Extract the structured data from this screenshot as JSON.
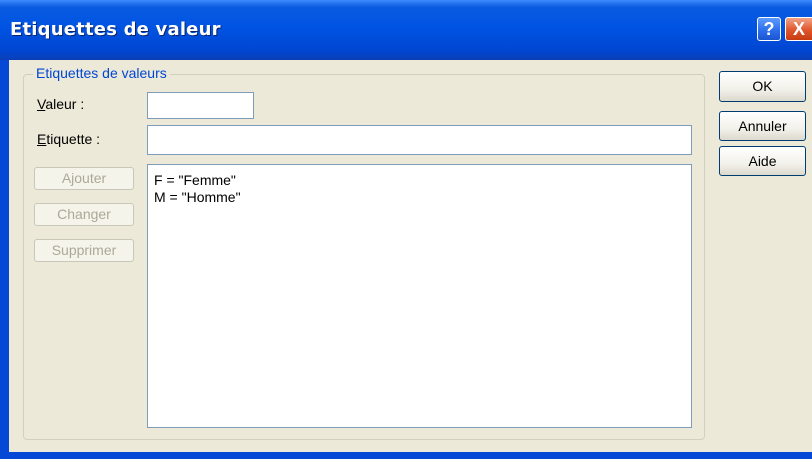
{
  "window": {
    "title": "Etiquettes de valeur"
  },
  "titlebar_buttons": {
    "help": "?",
    "close": "X"
  },
  "group": {
    "legend": "Etiquettes de valeurs"
  },
  "form": {
    "valeur_label": "Valeur :",
    "valeur_value": "",
    "etiquette_label": "Etiquette :",
    "etiquette_value": ""
  },
  "actions": {
    "ajouter": "Ajouter",
    "changer": "Changer",
    "supprimer": "Supprimer"
  },
  "list": {
    "items": [
      "F = \"Femme\"",
      "M = \"Homme\""
    ]
  },
  "dialog_buttons": {
    "ok": "OK",
    "annuler": "Annuler",
    "aide": "Aide"
  }
}
